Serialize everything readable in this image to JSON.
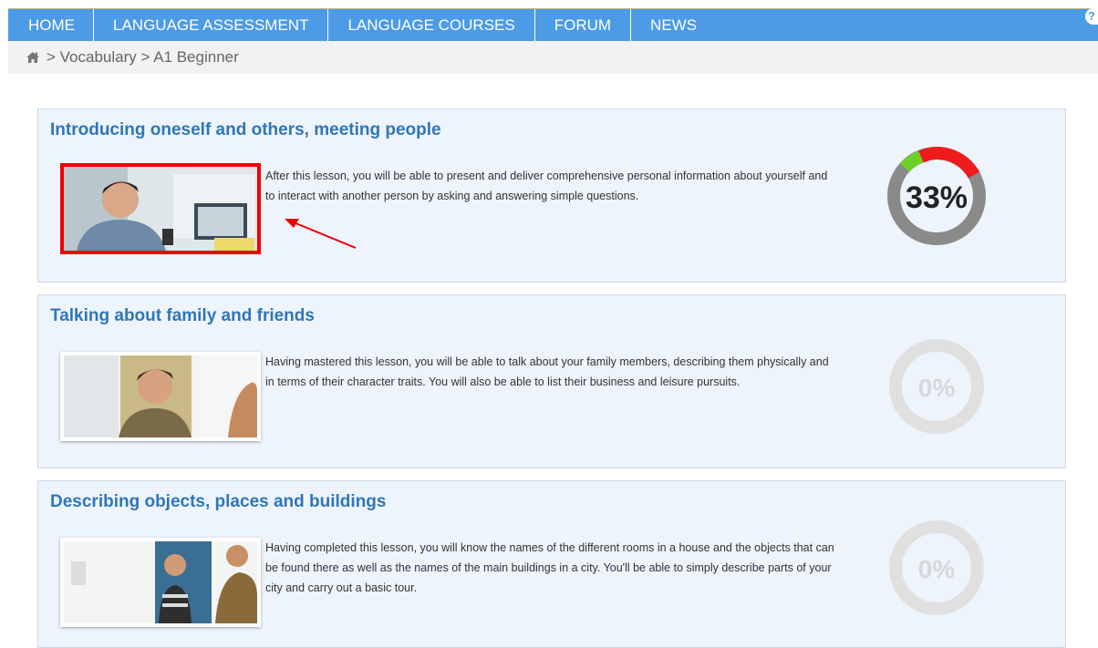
{
  "nav": {
    "items": [
      "HOME",
      "LANGUAGE ASSESSMENT",
      "LANGUAGE COURSES",
      "FORUM",
      "NEWS"
    ],
    "help_icon": "question-circle-icon",
    "help_symbol": "?"
  },
  "breadcrumb": {
    "home_icon": "home-icon",
    "trail": "> Vocabulary > A1 Beginner"
  },
  "lessons": [
    {
      "title": "Introducing oneself and others, meeting people",
      "description": "After this lesson, you will be able to present and deliver comprehensive personal information about yourself and to interact with another person by asking and answering simple questions.",
      "progress_label": "33%",
      "progress_value": 33,
      "highlighted": true
    },
    {
      "title": "Talking about family and friends",
      "description": "Having mastered this lesson, you will be able to talk about your family members, describing them physically and in terms of their character traits. You will also be able to list their business and leisure pursuits.",
      "progress_label": "0%",
      "progress_value": 0,
      "highlighted": false
    },
    {
      "title": "Describing objects, places and buildings",
      "description": "Having completed this lesson, you will know the names of the different rooms in a house and the objects that can be found there as well as the names of the main buildings in a city. You'll be able to simply describe parts of your city and carry out a basic tour.",
      "progress_label": "0%",
      "progress_value": 0,
      "highlighted": false
    }
  ],
  "colors": {
    "nav_bg": "#4c9be6",
    "title": "#2f76b6",
    "card_bg": "#eef4fc",
    "highlight": "#ee0000",
    "progress_red": "#ee1c1c",
    "progress_green": "#6fcf2a",
    "progress_gray": "#8a8a8a",
    "empty_ring": "#e0e0e0"
  }
}
